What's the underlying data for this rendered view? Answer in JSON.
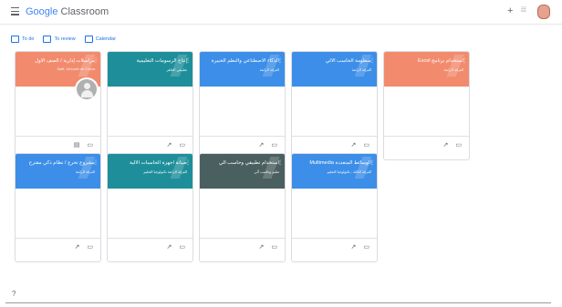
{
  "app": {
    "name_google": "Google",
    "name_rest": "Classroom"
  },
  "toolbar": {
    "add_icon": "+",
    "apps_icon": "⁞⁞⁞",
    "avatar": "user-avatar"
  },
  "tabs": [
    {
      "label": "To do"
    },
    {
      "label": "To review"
    },
    {
      "label": "Calendar"
    }
  ],
  "cards": [
    {
      "title": "مراسلات إدارية / الصف الأول",
      "subtitle": "Staff, Jehovah de Cheza",
      "color": "#f28b6e"
    },
    {
      "title": "إنتاج الرسومات التعليمية",
      "subtitle": "تطبيقي الجاهز",
      "color": "#1e8f9a"
    },
    {
      "title": "الذكاء الاصطناعي والنظم الخبيرة",
      "subtitle": "الفرقة الرابعة",
      "color": "#3c8ee8"
    },
    {
      "title": "منظومة الحاسب الآلي",
      "subtitle": "الفرقة الرابعة",
      "color": "#3c8ee8"
    },
    {
      "title": "Excel استخدام برنامج",
      "subtitle": "الفرقة الرابعة",
      "color": "#f28b6e"
    },
    {
      "title": "مشروع تخرج / نظام ذكي مقترح",
      "subtitle": "الفرقة الرابعة",
      "color": "#3c8ee8"
    },
    {
      "title": "صيانة أجهزة الحاسبات الآلية",
      "subtitle": "الفرقة الرابعة تكنولوجيا التعليم",
      "color": "#1e8f9a"
    },
    {
      "title": "استخدام تطبيقي وحاسب آلي",
      "subtitle": "تعليم وحاسب آلي",
      "color": "#4a5f5f"
    },
    {
      "title": "Multimedia الوسائط المتعددة",
      "subtitle": "الفرقة الثالثة - تكنولوجيا التعليم",
      "color": "#3c8ee8"
    }
  ],
  "footer": {
    "help_icon": "?"
  }
}
